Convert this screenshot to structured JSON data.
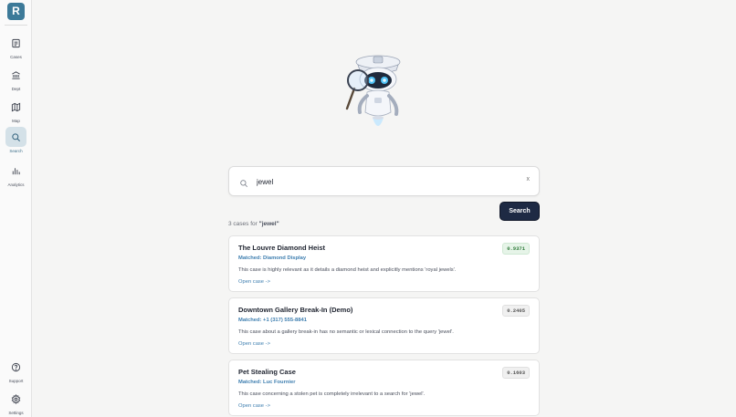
{
  "app": {
    "logo_letter": "R",
    "accent": "#3d7a99"
  },
  "sidebar": {
    "items": [
      {
        "label": "Cases",
        "icon": "document-icon"
      },
      {
        "label": "Dept",
        "icon": "bank-icon"
      },
      {
        "label": "Map",
        "icon": "map-icon"
      },
      {
        "label": "Search",
        "icon": "search-icon",
        "active": true
      },
      {
        "label": "Analytics",
        "icon": "bar-chart-icon"
      }
    ],
    "bottom": [
      {
        "label": "Support",
        "icon": "help-circle-icon"
      },
      {
        "label": "Settings",
        "icon": "gear-icon"
      }
    ]
  },
  "search": {
    "value": "jewel",
    "clear_label": "x",
    "button_label": "Search"
  },
  "results": {
    "count_prefix": "3 cases for ",
    "query_quoted": "\"jewel\""
  },
  "cards": [
    {
      "title": "The Louvre Diamond Heist",
      "score": "0.9371",
      "matched": "Matched: Diamond Display",
      "description": "This case is highly relevant as it details a diamond heist and explicitly mentions 'royal jewels'.",
      "link": "Open case ->"
    },
    {
      "title": "Downtown Gallery Break-In (Demo)",
      "score": "0.2405",
      "matched": "Matched: +1 (317) 555-8841",
      "description": "This case about a gallery break-in has no semantic or lexical connection to the query 'jewel'.",
      "link": "Open case ->"
    },
    {
      "title": "Pet Stealing Case",
      "score": "0.1603",
      "matched": "Matched: Luc Fournier",
      "description": "This case concerning a stolen pet is completely irrelevant to a search for 'jewel'.",
      "link": "Open case ->"
    }
  ]
}
